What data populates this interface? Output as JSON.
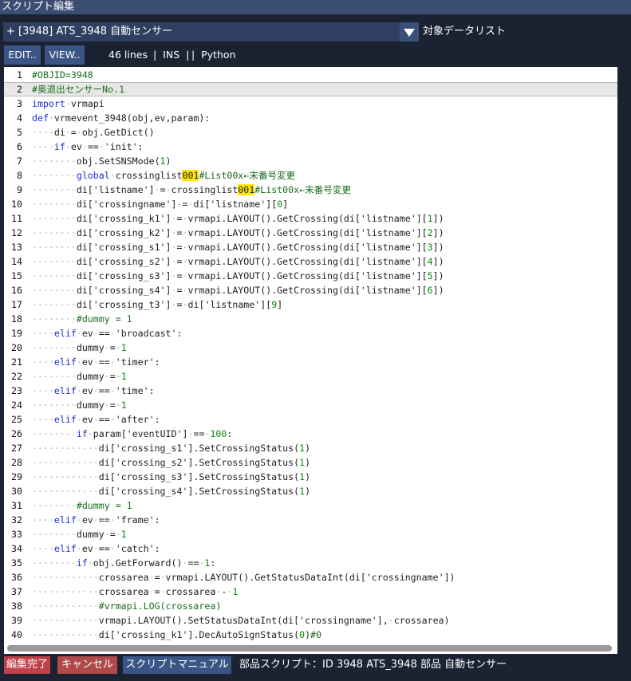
{
  "window": {
    "title": "スクリプト編集"
  },
  "object_selector": {
    "value": "+ [3948] ATS_3948 自動センサー",
    "target_label": "対象データリスト"
  },
  "toolbar": {
    "edit_label": "EDIT..",
    "view_label": "VIEW..",
    "line_count": "46 lines",
    "mode": "|  INS  |",
    "language": "|  Python"
  },
  "footer": {
    "done_label": "編集完了",
    "cancel_label": "キャンセル",
    "manual_label": "スクリプトマニュアル",
    "info": "部品スクリプト：ID 3948 ATS_3948 部品 自動センサー"
  },
  "colors": {
    "titlebar": "#3b4d73",
    "done": "#c0414a",
    "cancel": "#b04a4a",
    "manual": "#3a5585",
    "keyword": "#1a2fd6",
    "number": "#0a8a0a",
    "highlight": "#ffe800"
  },
  "code_lines": [
    "#OBJID=3948",
    "#奥退出センサーNo.1",
    "import vrmapi",
    "def vrmevent_3948(obj,ev,param):",
    "    di = obj.GetDict()",
    "    if ev == 'init':",
    "        obj.SetSNSMode(1)",
    "        global crossinglist001#List00x←末番号変更",
    "        di['listname'] = crossinglist001#List00x←末番号変更",
    "        di['crossingname'] = di['listname'][0]",
    "        di['crossing_k1'] = vrmapi.LAYOUT().GetCrossing(di['listname'][1])",
    "        di['crossing_k2'] = vrmapi.LAYOUT().GetCrossing(di['listname'][2])",
    "        di['crossing_s1'] = vrmapi.LAYOUT().GetCrossing(di['listname'][3])",
    "        di['crossing_s2'] = vrmapi.LAYOUT().GetCrossing(di['listname'][4])",
    "        di['crossing_s3'] = vrmapi.LAYOUT().GetCrossing(di['listname'][5])",
    "        di['crossing_s4'] = vrmapi.LAYOUT().GetCrossing(di['listname'][6])",
    "        di['crossing_t3'] = di['listname'][9]",
    "        #dummy = 1",
    "    elif ev == 'broadcast':",
    "        dummy = 1",
    "    elif ev == 'timer':",
    "        dummy = 1",
    "    elif ev == 'time':",
    "        dummy = 1",
    "    elif ev == 'after':",
    "        if param['eventUID'] == 100:",
    "            di['crossing_s1'].SetCrossingStatus(1)",
    "            di['crossing_s2'].SetCrossingStatus(1)",
    "            di['crossing_s3'].SetCrossingStatus(1)",
    "            di['crossing_s4'].SetCrossingStatus(1)",
    "        #dummy = 1",
    "    elif ev == 'frame':",
    "        dummy = 1",
    "    elif ev == 'catch':",
    "        if obj.GetForward() == 1:",
    "            crossarea = vrmapi.LAYOUT().GetStatusDataInt(di['crossingname'])",
    "            crossarea = crossarea - 1",
    "            #vrmapi.LOG(crossarea)",
    "            vrmapi.LAYOUT().SetStatusDataInt(di['crossingname'], crossarea)",
    "            di['crossing_k1'].DecAutoSignStatus(0)#0"
  ],
  "current_line": 2
}
